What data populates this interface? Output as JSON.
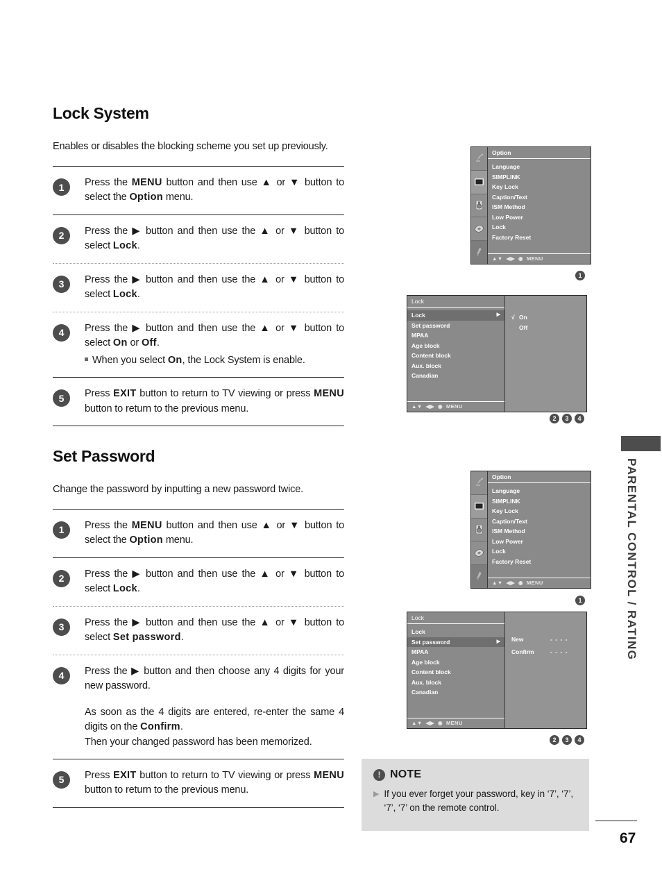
{
  "page": {
    "number": "67",
    "side_tab_label": "PARENTAL CONTROL / RATING"
  },
  "sections": [
    {
      "id": "lock-system",
      "title": "Lock System",
      "intro": "Enables or disables the blocking scheme you set up previously.",
      "steps": [
        {
          "num": "1",
          "text_html": "Press the <b>MENU</b> button and then use ▲ or ▼ button to select the <b>Option</b> menu.",
          "divider_after": "solid"
        },
        {
          "num": "2",
          "text_html": "Press the ▶ button and then use the ▲ or ▼ button to select <b>Lock</b>.",
          "divider_after": "dotted"
        },
        {
          "num": "3",
          "text_html": "Press the ▶ button and then use the ▲ or ▼ button to select <b>Lock</b>.",
          "divider_after": "dotted"
        },
        {
          "num": "4",
          "text_html": "Press the ▶ button and then use the ▲ or ▼ button to select <b>On</b> or <b>Off</b>.",
          "sub_text_html": "When you select <b>On</b>, the Lock System is enable.",
          "divider_after": "solid"
        },
        {
          "num": "5",
          "text_html": "Press <b>EXIT</b> button to return to TV viewing or press <b>MENU</b> button to return to the previous menu.",
          "divider_after": "solid"
        }
      ]
    },
    {
      "id": "set-password",
      "title": "Set Password",
      "intro": "Change the password by inputting a new password twice.",
      "steps": [
        {
          "num": "1",
          "text_html": "Press the <b>MENU</b> button and then use ▲ or ▼ button to select the <b>Option</b> menu.",
          "divider_after": "solid"
        },
        {
          "num": "2",
          "text_html": "Press the ▶ button and then use the ▲ or ▼ button to select <b>Lock</b>.",
          "divider_after": "dotted"
        },
        {
          "num": "3",
          "text_html": "Press the ▶ button and then use the ▲ or ▼ button to select <b>Set password</b>.",
          "divider_after": "dotted"
        },
        {
          "num": "4",
          "text_html": "Press the ▶ button and then choose any 4 digits for your new password.",
          "extra_html": "As soon as the 4 digits are entered, re-enter the same 4 digits on the <b>Confirm</b>.<br>Then your changed password has been memorized.",
          "divider_after": "solid"
        },
        {
          "num": "5",
          "text_html": "Press <b>EXIT</b> button to return to TV viewing or press <b>MENU</b> button to return to the previous menu.",
          "divider_after": "solid"
        }
      ]
    }
  ],
  "osd": {
    "option_menu": {
      "title": "Option",
      "items": [
        "Language",
        "SIMPLINK",
        "Key Lock",
        "Caption/Text",
        "ISM Method",
        "Low Power",
        "Lock",
        "Factory Reset"
      ],
      "footer": {
        "updown": "▲▼",
        "leftright": "◀▶",
        "enter": "◉",
        "menu": "MENU"
      },
      "rail_icons": [
        "satellite-antenna-icon",
        "picture-screen-icon",
        "speaker-audio-icon",
        "clock-time-icon",
        "setup-tool-icon"
      ],
      "rail_active_index": 1
    },
    "lock_menu_on_off": {
      "title": "Lock",
      "items": [
        "Lock",
        "Set password",
        "MPAA",
        "Age block",
        "Content block",
        "Aux. block",
        "Canadian"
      ],
      "selected_index": 0,
      "selected_arrow": "▶",
      "right_pane": {
        "rows": [
          {
            "check": "√",
            "label": "On",
            "value": ""
          },
          {
            "check": "",
            "label": "Off",
            "value": ""
          }
        ]
      },
      "footer": {
        "updown": "▲▼",
        "leftright": "◀▶",
        "enter": "◉",
        "menu": "MENU"
      }
    },
    "lock_menu_password": {
      "title": "Lock",
      "items": [
        "Lock",
        "Set password",
        "MPAA",
        "Age block",
        "Content block",
        "Aux. block",
        "Canadian"
      ],
      "selected_index": 1,
      "selected_arrow": "▶",
      "right_pane": {
        "rows": [
          {
            "check": "",
            "label": "New",
            "value": "- - - -"
          },
          {
            "check": "",
            "label": "Confirm",
            "value": "- - - -"
          }
        ]
      },
      "footer": {
        "updown": "▲▼",
        "leftright": "◀▶",
        "enter": "◉",
        "menu": "MENU"
      }
    },
    "markers": {
      "option_top": [
        "1"
      ],
      "lock_top": [
        "2",
        "3",
        "4"
      ],
      "option_bottom": [
        "1"
      ],
      "lock_bottom": [
        "2",
        "3",
        "4"
      ]
    }
  },
  "note": {
    "icon": "exclamation-icon",
    "icon_glyph": "!",
    "title": "NOTE",
    "bullet_glyph": "▶",
    "text": "If you ever forget your password, key in ‘7’, ‘7’, ‘7’, ‘7’ on the remote control."
  },
  "colors": {
    "ink": "#1a1a1a",
    "step_circle": "#4d4d4d",
    "osd_bg": "#8a8a8a",
    "osd_highlight": "#6f6f6f",
    "note_bg": "#dcdcdc",
    "side_tab": "#4d4d4d"
  }
}
